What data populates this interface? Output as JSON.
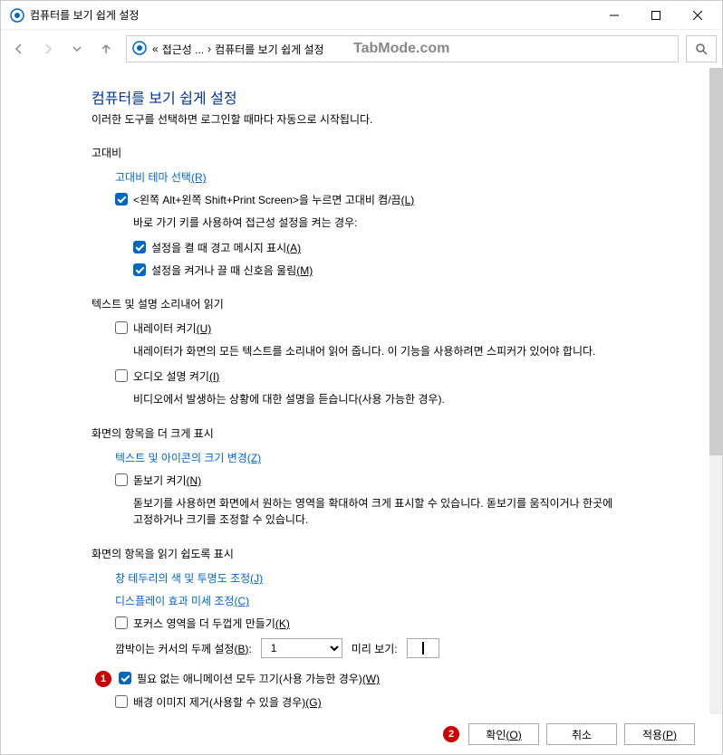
{
  "window": {
    "title": "컴퓨터를 보기 쉽게 설정"
  },
  "breadcrumb": {
    "prefix": "«",
    "item1": "접근성 ...",
    "sep": "›",
    "item2": "컴퓨터를 보기 쉽게 설정"
  },
  "watermark": "TabMode.com",
  "page": {
    "title": "컴퓨터를 보기 쉽게 설정",
    "subtitle": "이러한 도구를 선택하면 로그인할 때마다 자동으로 시작됩니다."
  },
  "sections": {
    "contrast": {
      "title": "고대비",
      "link_theme": "고대비 테마 선택",
      "link_theme_key": "(R)",
      "check_toggle": "<왼쪽 Alt+왼쪽 Shift+Print Screen>을 누르면 고대비 켬/끔",
      "check_toggle_key": "(L)",
      "subhelp": "바로 가기 키를 사용하여 접근성 설정을 켜는 경우:",
      "check_warn": "설정을 켤 때 경고 메시지 표시",
      "check_warn_key": "(A)",
      "check_sound": "설정을 켜거나 끌 때 신호음 울림",
      "check_sound_key": "(M)"
    },
    "narrator": {
      "title": "텍스트 및 설명 소리내어 읽기",
      "check_narr": "내레이터 켜기",
      "check_narr_key": "(U)",
      "narr_help": "내레이터가 화면의 모든 텍스트를 소리내어 읽어 줍니다. 이 기능을 사용하려면 스피커가 있어야 합니다.",
      "check_audio": "오디오 설명 켜기",
      "check_audio_key": "(I)",
      "audio_help": "비디오에서 발생하는 상황에 대한 설명을 듣습니다(사용 가능한 경우)."
    },
    "larger": {
      "title": "화면의 항목을 더 크게 표시",
      "link_size": "텍스트 및 아이콘의 크기 변경",
      "link_size_key": "(Z)",
      "check_mag": "돋보기 켜기",
      "check_mag_key": "(N)",
      "mag_help": "돋보기를 사용하면 화면에서 원하는 영역을 확대하여 크게 표시할 수 있습니다. 돋보기를 움직이거나 한곳에 고정하거나 크기를 조정할 수 있습니다."
    },
    "easier": {
      "title": "화면의 항목을 읽기 쉽도록 표시",
      "link_border": "창 테두리의 색 및 투명도 조정",
      "link_border_key": "(J)",
      "link_display": "디스플레이 효과 미세 조정",
      "link_display_key": "(C)",
      "check_focus": "포커스 영역을 더 두껍게 만들기",
      "check_focus_key": "(K)",
      "cursor_label": "깜박이는 커서의 두께 설정",
      "cursor_label_key": "(B)",
      "cursor_value": "1",
      "preview_label": "미리 보기:",
      "check_anim": "필요 없는 애니메이션 모두 끄기(사용 가능한 경우)",
      "check_anim_key": "(W)",
      "check_bg": "배경 이미지 제거(사용할 수 있을 경우)",
      "check_bg_key": "(G)"
    }
  },
  "footer": {
    "ok": "확인",
    "ok_key": "(O)",
    "cancel": "취소",
    "apply": "적용",
    "apply_key": "(P)"
  },
  "badges": {
    "one": "1",
    "two": "2"
  }
}
